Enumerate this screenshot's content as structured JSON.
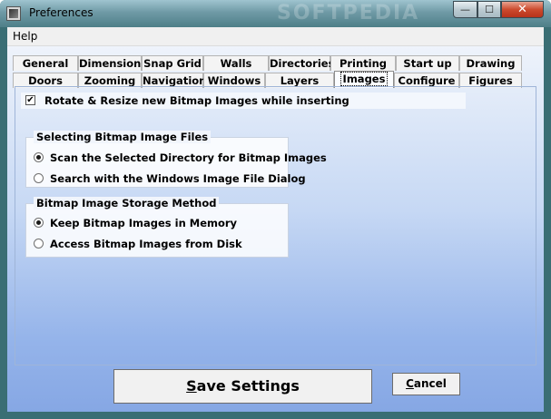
{
  "window": {
    "title": "Preferences",
    "watermark": "SOFTPEDIA"
  },
  "title_buttons": {
    "minimize": "—",
    "maximize": "☐",
    "close": "✕"
  },
  "menu": {
    "help": "Help"
  },
  "tabs_row1": [
    "General",
    "Dimensions",
    "Snap Grid",
    "Walls",
    "Directories",
    "Printing",
    "Start up",
    "Drawing"
  ],
  "tabs_row2": [
    "Doors",
    "Zooming",
    "Navigation",
    "Windows",
    "Layers",
    "Images",
    "Configure",
    "Figures"
  ],
  "active_tab": "Images",
  "images": {
    "rotate_resize": {
      "label": "Rotate & Resize new Bitmap Images while inserting",
      "checked": true,
      "mark": "✔"
    },
    "selecting_group": {
      "title": "Selecting Bitmap Image Files",
      "options": [
        {
          "label": "Scan the Selected Directory for Bitmap Images",
          "selected": true
        },
        {
          "label": "Search with the Windows Image File Dialog",
          "selected": false
        }
      ]
    },
    "storage_group": {
      "title": "Bitmap Image Storage Method",
      "options": [
        {
          "label": "Keep Bitmap Images in Memory",
          "selected": true
        },
        {
          "label": "Access Bitmap Images from Disk",
          "selected": false
        }
      ]
    }
  },
  "buttons": {
    "save": {
      "accel": "S",
      "rest": "ave Settings"
    },
    "cancel": {
      "accel": "C",
      "rest": "ancel"
    }
  }
}
